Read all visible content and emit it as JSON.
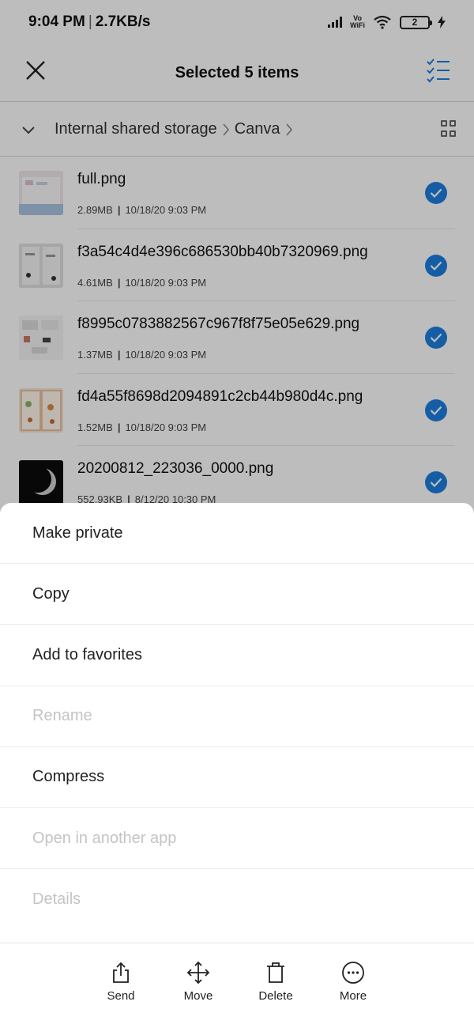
{
  "status_bar": {
    "time": "9:04 PM",
    "speed": "2.7KB/s",
    "vowifi_top": "Vo",
    "vowifi_bottom": "WiFi",
    "battery": "2"
  },
  "app_bar": {
    "title": "Selected 5 items",
    "close_icon": "close-icon",
    "select_all_icon": "checklist-icon",
    "accent": "#1d7fe0"
  },
  "path_bar": {
    "crumbs": [
      "Internal shared storage",
      "Canva"
    ]
  },
  "files": [
    {
      "name": "full.png",
      "size": "2.89MB",
      "date": "10/18/20 9:03 PM",
      "selected": true
    },
    {
      "name": "f3a54c4d4e396c686530bb40b7320969.png",
      "size": "4.61MB",
      "date": "10/18/20 9:03 PM",
      "selected": true
    },
    {
      "name": "f8995c0783882567c967f8f75e05e629.png",
      "size": "1.37MB",
      "date": "10/18/20 9:03 PM",
      "selected": true
    },
    {
      "name": "fd4a55f8698d2094891c2cb44b980d4c.png",
      "size": "1.52MB",
      "date": "10/18/20 9:03 PM",
      "selected": true
    },
    {
      "name": "20200812_223036_0000.png",
      "size": "552.93KB",
      "date": "8/12/20 10:30 PM",
      "selected": true
    }
  ],
  "sheet": {
    "items": [
      {
        "label": "Make private",
        "enabled": true
      },
      {
        "label": "Copy",
        "enabled": true
      },
      {
        "label": "Add to favorites",
        "enabled": true
      },
      {
        "label": "Rename",
        "enabled": false
      },
      {
        "label": "Compress",
        "enabled": true
      },
      {
        "label": "Open in another app",
        "enabled": false
      },
      {
        "label": "Details",
        "enabled": false
      }
    ]
  },
  "bottom_nav": {
    "send": "Send",
    "move": "Move",
    "delete": "Delete",
    "more": "More"
  }
}
